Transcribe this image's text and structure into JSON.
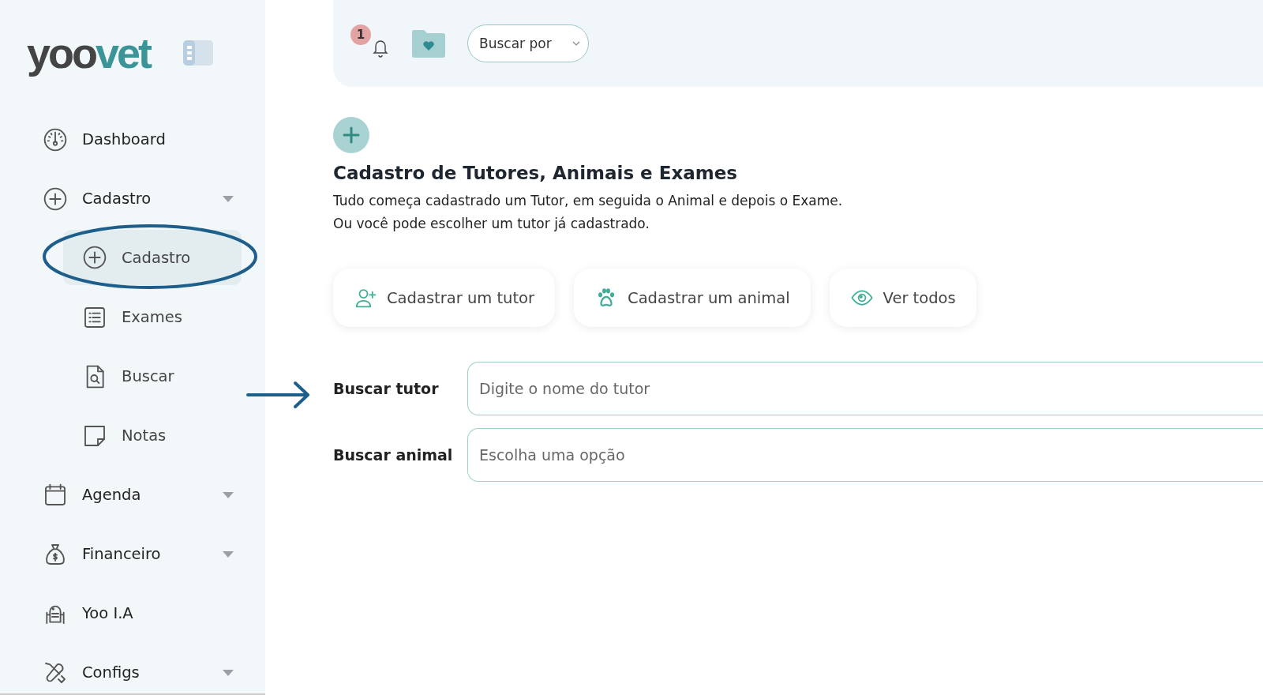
{
  "logo": {
    "dark": "yoo",
    "accent": "vet"
  },
  "sidebar": {
    "items": [
      {
        "label": "Dashboard",
        "dropdown": false,
        "selected": false
      },
      {
        "label": "Cadastro",
        "dropdown": true,
        "selected": false,
        "children": [
          {
            "label": "Cadastro",
            "selected": true
          },
          {
            "label": "Exames",
            "selected": false
          },
          {
            "label": "Buscar",
            "selected": false
          },
          {
            "label": "Notas",
            "selected": false
          }
        ]
      },
      {
        "label": "Agenda",
        "dropdown": true,
        "selected": false
      },
      {
        "label": "Financeiro",
        "dropdown": true,
        "selected": false
      },
      {
        "label": "Yoo I.A",
        "dropdown": false,
        "selected": false
      },
      {
        "label": "Configs",
        "dropdown": true,
        "selected": false
      }
    ]
  },
  "header": {
    "notification_count": "1",
    "search_select": "Buscar por"
  },
  "main": {
    "title": "Cadastro de Tutores, Animais e Exames",
    "description": [
      "Tudo começa cadastrado um Tutor, em seguida o Animal e depois o Exame.",
      "Ou você pode escolher um tutor já cadastrado."
    ],
    "actions": [
      {
        "label": "Cadastrar um tutor"
      },
      {
        "label": "Cadastrar um animal"
      },
      {
        "label": "Ver todos"
      }
    ],
    "fields": [
      {
        "label": "Buscar tutor",
        "placeholder": "Digite o nome do tutor"
      },
      {
        "label": "Buscar animal",
        "placeholder": "Escolha uma opção"
      }
    ]
  }
}
